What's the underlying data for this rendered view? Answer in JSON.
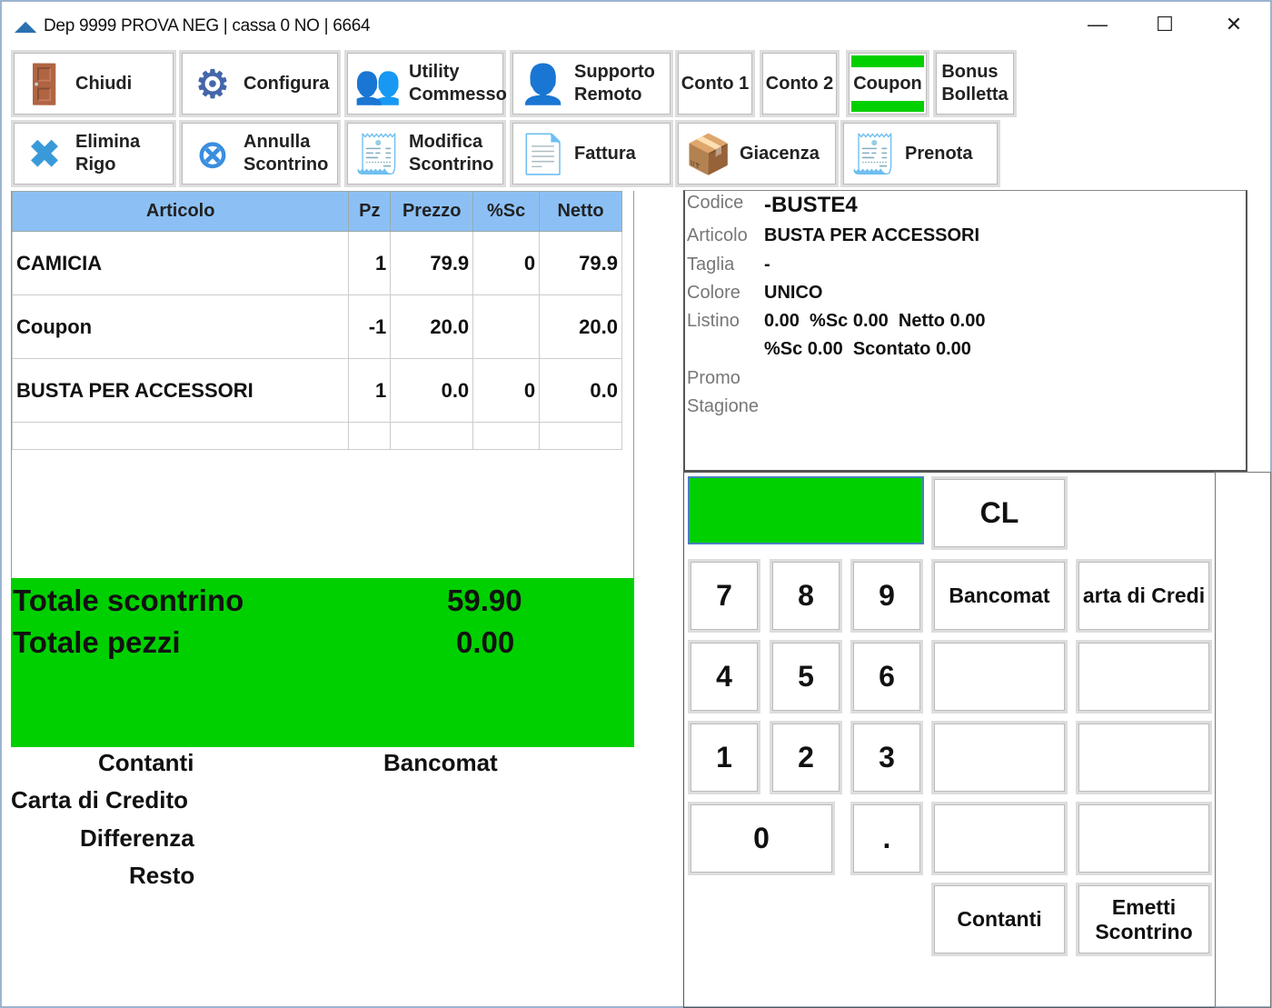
{
  "window": {
    "title": "Dep 9999 PROVA NEG | cassa 0 NO  | 6664",
    "minimize": "—",
    "maximize": "☐",
    "close": "✕"
  },
  "toolbar": {
    "row1": [
      {
        "id": "chiudi",
        "l1": "Chiudi",
        "l2": "",
        "icon": "exit-door-icon"
      },
      {
        "id": "configura",
        "l1": "Configura",
        "l2": "",
        "icon": "gear-icon"
      },
      {
        "id": "utility",
        "l1": "Utility",
        "l2": "Commesso",
        "icon": "users-icon"
      },
      {
        "id": "supporto",
        "l1": "Supporto",
        "l2": "Remoto",
        "icon": "support-agent-icon"
      },
      {
        "id": "conto1",
        "l1": "Conto 1",
        "l2": ""
      },
      {
        "id": "conto2",
        "l1": "Conto 2",
        "l2": ""
      },
      {
        "id": "coupon",
        "l1": "Coupon",
        "l2": ""
      },
      {
        "id": "bonus",
        "l1": "Bonus",
        "l2": "Bolletta"
      }
    ],
    "row2": [
      {
        "id": "elimina",
        "l1": "Elimina",
        "l2": "Rigo",
        "icon": "x-icon"
      },
      {
        "id": "annulla",
        "l1": "Annulla",
        "l2": "Scontrino",
        "icon": "cancel-circle-icon"
      },
      {
        "id": "modifica",
        "l1": "Modifica",
        "l2": "Scontrino",
        "icon": "receipt-icon"
      },
      {
        "id": "fattura",
        "l1": "Fattura",
        "l2": "",
        "icon": "invoice-icon"
      },
      {
        "id": "giacenza",
        "l1": "Giacenza",
        "l2": "",
        "icon": "box-icon"
      },
      {
        "id": "prenota",
        "l1": "Prenota",
        "l2": "",
        "icon": "receipt-icon"
      }
    ]
  },
  "table": {
    "headers": [
      "Articolo",
      "Pz",
      "Prezzo",
      "%Sc",
      "Netto"
    ],
    "rows": [
      [
        "CAMICIA",
        "1",
        "79.9",
        "0",
        "79.9"
      ],
      [
        "Coupon",
        "-1",
        "20.0",
        "",
        "20.0"
      ],
      [
        "BUSTA PER ACCESSORI",
        "1",
        "0.0",
        "0",
        "0.0"
      ],
      [
        "",
        "",
        "",
        "",
        ""
      ]
    ]
  },
  "totals": {
    "scontrino_label": "Totale scontrino",
    "scontrino_value": "59.90",
    "pezzi_label": "Totale pezzi",
    "pezzi_value": "0.00",
    "color": "#00d000"
  },
  "payments": {
    "contanti": "Contanti",
    "bancomat": "Bancomat",
    "carta": "Carta di Credito",
    "differenza": "Differenza",
    "resto": "Resto"
  },
  "info": {
    "codice_k": "Codice",
    "codice_v": "-BUSTE4",
    "articolo_k": "Articolo",
    "articolo_v": "BUSTA PER ACCESSORI",
    "taglia_k": "Taglia",
    "taglia_v": "-",
    "colore_k": "Colore",
    "colore_v": "UNICO",
    "listino_k": "Listino",
    "listino_v": "0.00  %Sc 0.00  Netto 0.00",
    "listino_v2": "%Sc 0.00  Scontato 0.00",
    "promo_k": "Promo",
    "stagione_k": "Stagione"
  },
  "keypad": {
    "display": "",
    "cl": "CL",
    "k7": "7",
    "k8": "8",
    "k9": "9",
    "k4": "4",
    "k5": "5",
    "k6": "6",
    "k1": "1",
    "k2": "2",
    "k3": "3",
    "k0": "0",
    "dot": ".",
    "bancomat": "Bancomat",
    "carta": "arta di Credi",
    "contanti": "Contanti",
    "emetti1": "Emetti",
    "emetti2": "Scontrino"
  }
}
